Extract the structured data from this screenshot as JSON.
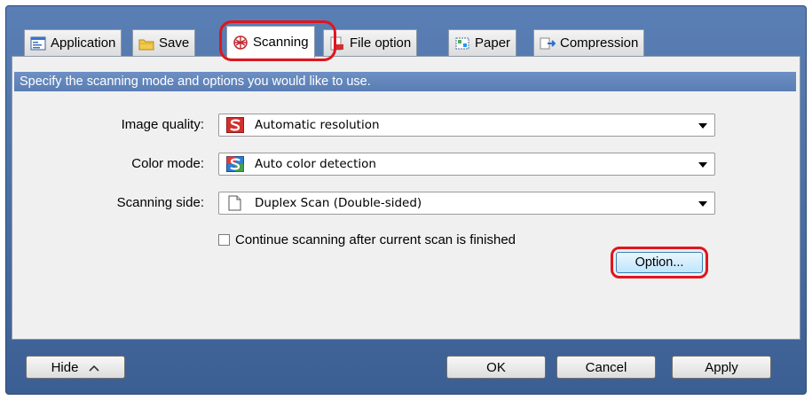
{
  "tabs": [
    {
      "label": "Application",
      "icon": "application-icon"
    },
    {
      "label": "Save",
      "icon": "folder-icon"
    },
    {
      "label": "Scanning",
      "icon": "scanning-icon",
      "active": true
    },
    {
      "label": "File option",
      "icon": "file-option-icon"
    },
    {
      "label": "Paper",
      "icon": "paper-icon"
    },
    {
      "label": "Compression",
      "icon": "compression-icon"
    }
  ],
  "banner": "Specify the scanning mode and options you would like to use.",
  "fields": {
    "image_quality": {
      "label": "Image quality:",
      "value": "Automatic resolution",
      "icon": "scansnap-red-icon"
    },
    "color_mode": {
      "label": "Color mode:",
      "value": "Auto color detection",
      "icon": "scansnap-color-icon"
    },
    "scanning_side": {
      "label": "Scanning side:",
      "value": "Duplex Scan (Double-sided)",
      "icon": "duplex-page-icon"
    }
  },
  "continue_scanning": {
    "label": "Continue scanning after current scan is finished",
    "checked": false
  },
  "option_button": "Option...",
  "footer": {
    "hide": "Hide",
    "ok": "OK",
    "cancel": "Cancel",
    "apply": "Apply"
  },
  "colors": {
    "window": "#4a6fa5",
    "banner": "#6487bd",
    "highlight": "#e0151f",
    "panel": "#f0f0f0"
  }
}
